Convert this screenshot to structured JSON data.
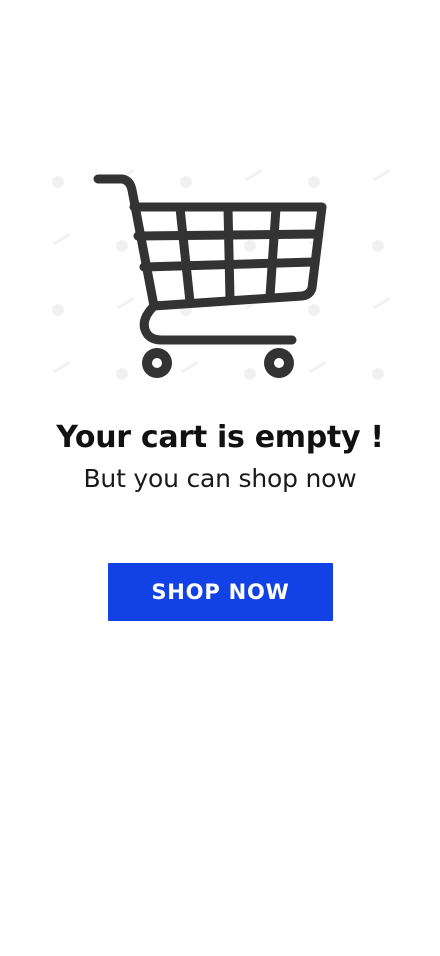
{
  "empty_state": {
    "illustration_icon": "shopping-cart-icon",
    "title": "Your cart is empty !",
    "subtitle": "But you can shop now",
    "cta_label": "SHOP NOW"
  },
  "colors": {
    "background": "#ffffff",
    "cart_stroke": "#333333",
    "watermark": "#f2f2f2",
    "button_bg": "#1242e6",
    "button_text": "#ffffff",
    "title_text": "#111111"
  }
}
